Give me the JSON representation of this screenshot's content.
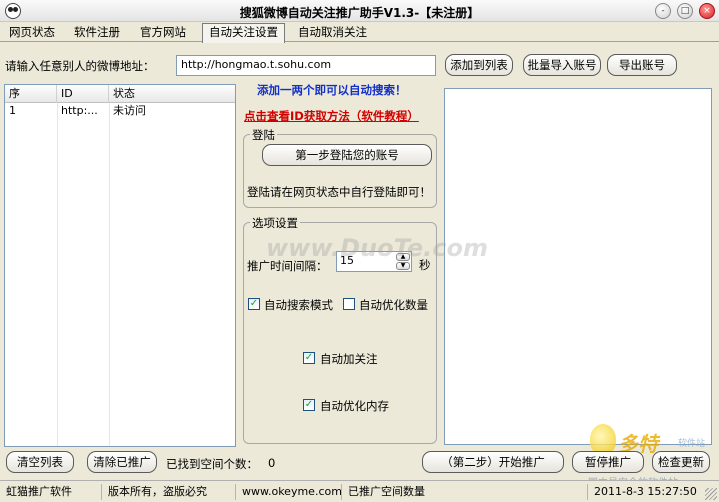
{
  "window": {
    "title": "搜狐微博自动关注推广助手V1.3-【未注册】",
    "minimize": "-",
    "maximize": "□",
    "close": "×"
  },
  "tabs": [
    {
      "label": "网页状态"
    },
    {
      "label": "软件注册"
    },
    {
      "label": "官方网站"
    },
    {
      "label": "自动关注设置",
      "active": true
    },
    {
      "label": "自动取消关注"
    }
  ],
  "address": {
    "label": "请输入任意别人的微博地址：",
    "value": "http://hongmao.t.sohu.com"
  },
  "buttons": {
    "add_to_list": "添加到列表",
    "batch_import": "批量导入账号",
    "export": "导出账号",
    "login_step1": "第一步登陆您的账号",
    "clear_list": "清空列表",
    "clear_promoted": "清除已推广",
    "start_promotion": "（第二步）开始推广",
    "pause_promotion": "暂停推广",
    "check_update": "检查更新"
  },
  "list": {
    "columns": [
      "序",
      "ID",
      "状态"
    ],
    "rows": [
      {
        "seq": "1",
        "id": "http:...",
        "status": "未访问"
      }
    ]
  },
  "hints": {
    "search_tip": "添加一两个即可以自动搜索！",
    "id_method_link": "点击查看ID获取方法（软件教程）"
  },
  "login_group": {
    "title": "登陆",
    "note": "登陆请在网页状态中自行登陆即可！"
  },
  "options": {
    "title": "选项设置",
    "interval_label": "推广时间间隔：",
    "interval_value": "15",
    "interval_unit": "秒",
    "auto_search": {
      "label": "自动搜索模式",
      "checked": true
    },
    "auto_optimize_count": {
      "label": "自动优化数量",
      "checked": false
    },
    "auto_follow": {
      "label": "自动加关注",
      "checked": true
    },
    "auto_optimize_memory": {
      "label": "自动优化内存",
      "checked": true
    }
  },
  "found_space": {
    "label": "已找到空间个数：",
    "value": "0"
  },
  "statusbar": {
    "app": "虹猫推广软件",
    "copyright": "版本所有，盗版必究",
    "site": "www.okeyme.com",
    "promoted_count": "已推广空间数量",
    "datetime": "2011-8-3 15:27:50"
  },
  "watermarks": {
    "center": "www.DuoTe.com",
    "brand": "多特",
    "brand_small": "软件站",
    "tagline": "国内最安全的软件站"
  }
}
